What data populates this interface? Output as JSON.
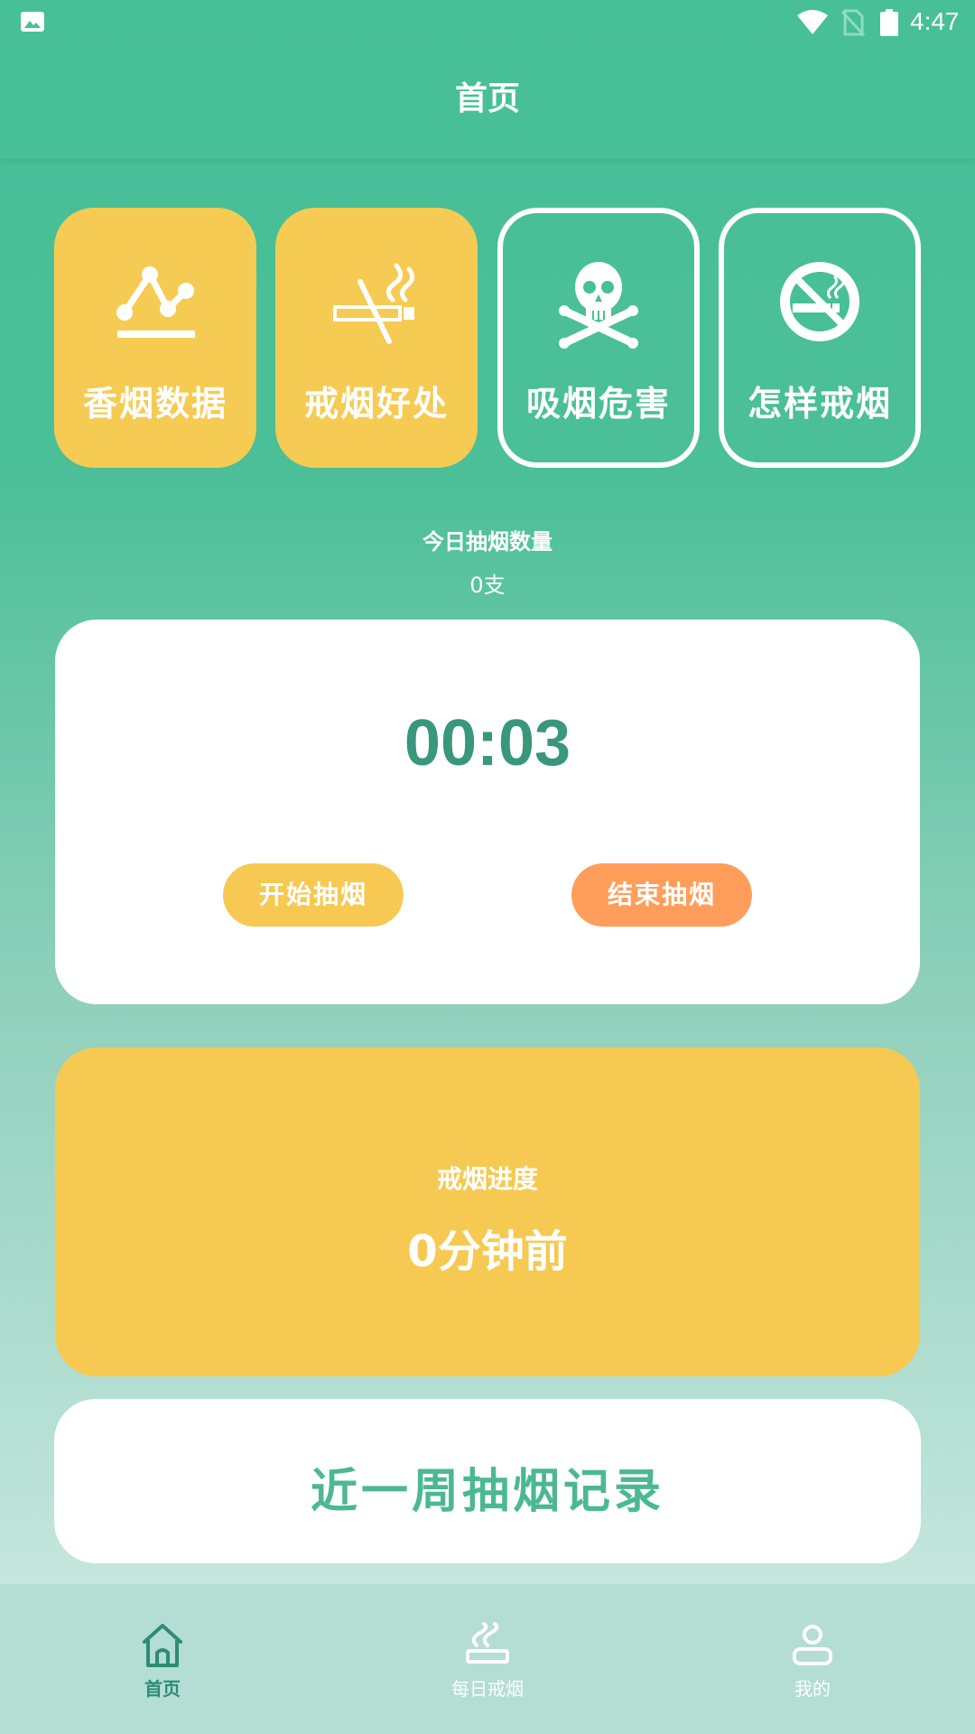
{
  "status_bar": {
    "time": "4:47"
  },
  "app_bar": {
    "title": "首页"
  },
  "tiles": [
    {
      "label": "香烟数据",
      "icon": "chart-icon",
      "style": "yellow"
    },
    {
      "label": "戒烟好处",
      "icon": "no-smoking-cigarette-icon",
      "style": "yellow"
    },
    {
      "label": "吸烟危害",
      "icon": "skull-crossbones-icon",
      "style": "outline"
    },
    {
      "label": "怎样戒烟",
      "icon": "no-smoking-sign-icon",
      "style": "outline"
    }
  ],
  "today_count": {
    "label": "今日抽烟数量",
    "value": "0支"
  },
  "timer": {
    "display": "00:03",
    "start_label": "开始抽烟",
    "end_label": "结束抽烟"
  },
  "progress": {
    "label": "戒烟进度",
    "value": "0分钟前"
  },
  "weekly": {
    "label": "近一周抽烟记录"
  },
  "bottom_nav": [
    {
      "label": "首页",
      "icon": "home-icon",
      "active": true
    },
    {
      "label": "每日戒烟",
      "icon": "cigarette-icon",
      "active": false
    },
    {
      "label": "我的",
      "icon": "profile-icon",
      "active": false
    }
  ],
  "colors": {
    "primary": "#47bf97",
    "accent_yellow": "#f6cb53",
    "accent_orange": "#ff9e5b",
    "timer_text": "#38977d",
    "active_nav": "#2d8d74"
  }
}
